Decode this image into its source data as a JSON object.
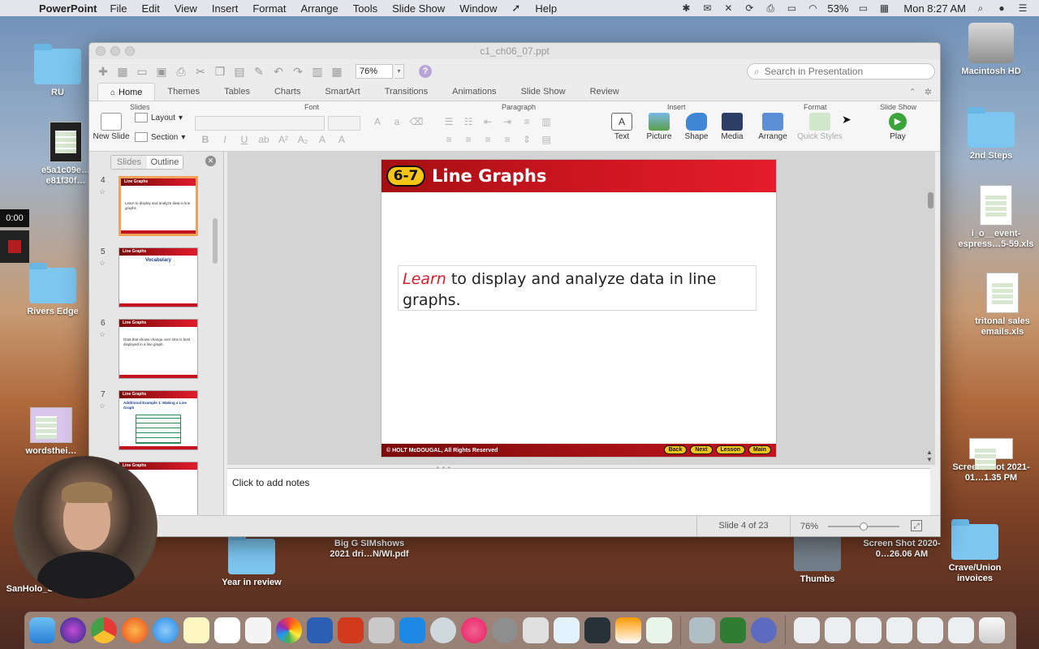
{
  "menubar": {
    "app": "PowerPoint",
    "menus": [
      "File",
      "Edit",
      "View",
      "Insert",
      "Format",
      "Arrange",
      "Tools",
      "Slide Show",
      "Window",
      "Help"
    ],
    "battery": "53%",
    "clock": "Mon 8:27 AM"
  },
  "desktop": {
    "icons": [
      "RU",
      "e5a1c09e… e81f30f…",
      "Rivers Edge",
      "wordsthei…",
      "Macintosh HD",
      "2nd Steps",
      "i_o__event-espress…5-59.xls",
      "tritonal sales emails.xls",
      "Screen Shot 2021-01…1.35 PM",
      "Thumbs",
      "Screen Shot 2020-0…26.06 AM",
      "Crave/Union invoices",
      "Year in review",
      "Big G SIMshows 2021 dri…N/WI.pdf",
      "SanHolo_S… mov"
    ]
  },
  "recording": {
    "time": "0:00"
  },
  "window": {
    "title": "c1_ch06_07.ppt",
    "zoom": "76%",
    "search_placeholder": "Search in Presentation"
  },
  "ribbon": {
    "tabs": [
      "Home",
      "Themes",
      "Tables",
      "Charts",
      "SmartArt",
      "Transitions",
      "Animations",
      "Slide Show",
      "Review"
    ],
    "groups": [
      "Slides",
      "Font",
      "Paragraph",
      "Insert",
      "Format",
      "Slide Show"
    ],
    "new_slide": "New Slide",
    "layout": "Layout",
    "section": "Section",
    "insert_items": [
      "Text",
      "Picture",
      "Shape",
      "Media"
    ],
    "format_items": [
      "Arrange",
      "Quick Styles"
    ],
    "play": "Play"
  },
  "sidepane": {
    "tabs": [
      "Slides",
      "Outline"
    ],
    "thumbs": [
      {
        "num": "4",
        "title": "Line Graphs",
        "text": "Learn to display and analyze data in line graphs."
      },
      {
        "num": "5",
        "title": "Line Graphs",
        "text": "Vocabulary"
      },
      {
        "num": "6",
        "title": "Line Graphs",
        "text": "Data that shows change over time is best displayed in a line graph."
      },
      {
        "num": "7",
        "title": "Line Graphs",
        "text": "Additional Example 1: Making a Line Graph"
      },
      {
        "num": "8",
        "title": "Line Graphs",
        "text": ""
      }
    ]
  },
  "slide": {
    "badge": "6-7",
    "title": "Line Graphs",
    "learn": "Learn",
    "body": " to display and analyze data in line graphs.",
    "copyright": "© HOLT McDOUGAL, All Rights Reserved",
    "nav": [
      "Back",
      "Next",
      "Lesson",
      "Main"
    ]
  },
  "notes": {
    "placeholder": "Click to add notes"
  },
  "status": {
    "slide_count": "Slide 4 of 23",
    "zoom": "76%",
    "zoom_level": 0.5
  }
}
